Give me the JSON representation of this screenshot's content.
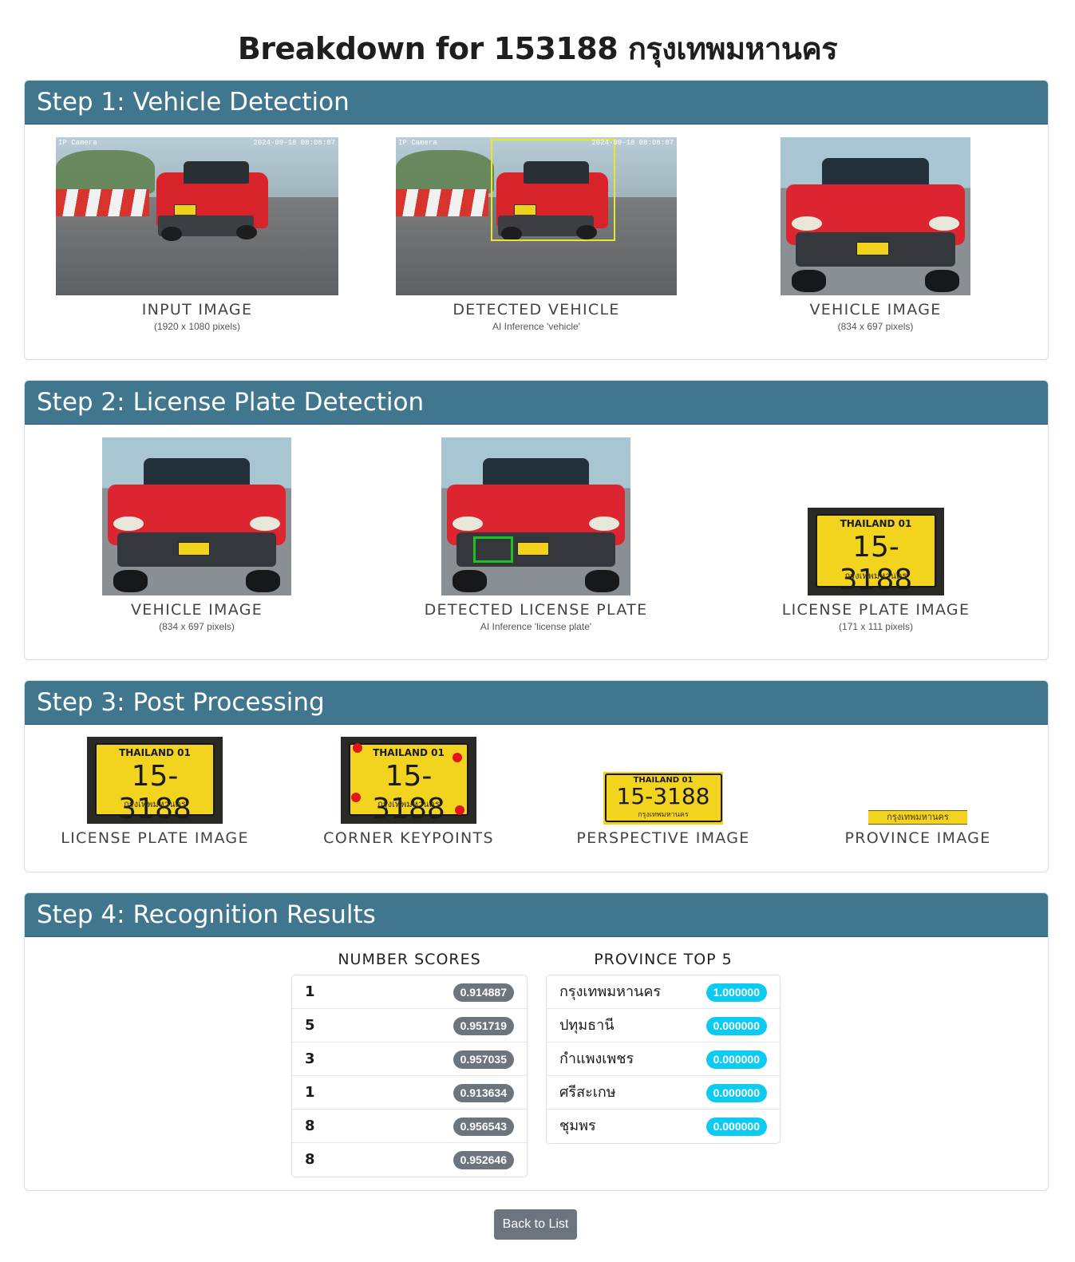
{
  "page": {
    "title": "Breakdown for 153188 กรุงเทพมหานคร"
  },
  "step1": {
    "header": "Step 1: Vehicle Detection",
    "figures": [
      {
        "label": "INPUT IMAGE",
        "sub": "(1920 x 1080 pixels)",
        "stamp_left": "IP Camera",
        "stamp_right": "2024-09-18 08:06:07"
      },
      {
        "label": "DETECTED VEHICLE",
        "sub": "AI Inference 'vehicle'",
        "stamp_left": "IP Camera",
        "stamp_right": "2024-09-18 08:06:07"
      },
      {
        "label": "VEHICLE IMAGE",
        "sub": "(834 x 697 pixels)"
      }
    ]
  },
  "step2": {
    "header": "Step 2: License Plate Detection",
    "figures": [
      {
        "label": "VEHICLE IMAGE",
        "sub": "(834 x 697 pixels)"
      },
      {
        "label": "DETECTED LICENSE PLATE",
        "sub": "AI Inference 'license plate'"
      },
      {
        "label": "LICENSE PLATE IMAGE",
        "sub": "(171 x 111 pixels)"
      }
    ]
  },
  "plate": {
    "top": "THAILAND 01",
    "number": "15-3188",
    "province": "กรุงเทพมหานคร"
  },
  "step3": {
    "header": "Step 3: Post Processing",
    "figures": [
      {
        "label": "LICENSE PLATE IMAGE"
      },
      {
        "label": "CORNER KEYPOINTS"
      },
      {
        "label": "PERSPECTIVE IMAGE"
      },
      {
        "label": "PROVINCE IMAGE"
      }
    ]
  },
  "step4": {
    "header": "Step 4: Recognition Results",
    "number_scores": {
      "title": "NUMBER SCORES",
      "rows": [
        {
          "char": "1",
          "score": "0.914887"
        },
        {
          "char": "5",
          "score": "0.951719"
        },
        {
          "char": "3",
          "score": "0.957035"
        },
        {
          "char": "1",
          "score": "0.913634"
        },
        {
          "char": "8",
          "score": "0.956543"
        },
        {
          "char": "8",
          "score": "0.952646"
        }
      ]
    },
    "province_top5": {
      "title": "PROVINCE TOP 5",
      "rows": [
        {
          "name": "กรุงเทพมหานคร",
          "score": "1.000000"
        },
        {
          "name": "ปทุมธานี",
          "score": "0.000000"
        },
        {
          "name": "กำแพงเพชร",
          "score": "0.000000"
        },
        {
          "name": "ศรีสะเกษ",
          "score": "0.000000"
        },
        {
          "name": "ชุมพร",
          "score": "0.000000"
        }
      ]
    }
  },
  "actions": {
    "back": "Back to List"
  },
  "colors": {
    "header_bg": "#41768f",
    "badge_grey": "#6c757d",
    "badge_cyan": "#0dcaf0",
    "bbox_vehicle": "#ebe81d",
    "bbox_plate": "#1fc11f",
    "keypoint": "#e4141b"
  }
}
